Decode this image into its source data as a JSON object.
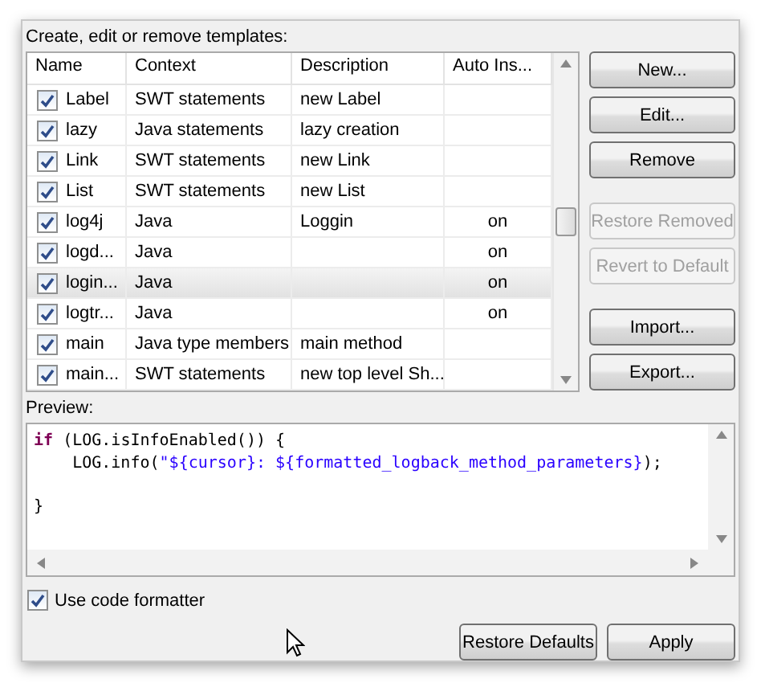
{
  "templates": {
    "label": "Create, edit or remove templates:",
    "columns": [
      "Name",
      "Context",
      "Description",
      "Auto Ins..."
    ],
    "rows": [
      {
        "checked": true,
        "selected": false,
        "name": "Label",
        "context": "SWT statements",
        "description": "new Label",
        "auto_insert": ""
      },
      {
        "checked": true,
        "selected": false,
        "name": "lazy",
        "context": "Java statements",
        "description": "lazy creation",
        "auto_insert": ""
      },
      {
        "checked": true,
        "selected": false,
        "name": "Link",
        "context": "SWT statements",
        "description": "new Link",
        "auto_insert": ""
      },
      {
        "checked": true,
        "selected": false,
        "name": "List",
        "context": "SWT statements",
        "description": "new List",
        "auto_insert": ""
      },
      {
        "checked": true,
        "selected": false,
        "name": "log4j",
        "context": "Java",
        "description": "Loggin",
        "auto_insert": "on"
      },
      {
        "checked": true,
        "selected": false,
        "name": "logd...",
        "context": "Java",
        "description": "",
        "auto_insert": "on"
      },
      {
        "checked": true,
        "selected": true,
        "name": "login...",
        "context": "Java",
        "description": "",
        "auto_insert": "on"
      },
      {
        "checked": true,
        "selected": false,
        "name": "logtr...",
        "context": "Java",
        "description": "",
        "auto_insert": "on"
      },
      {
        "checked": true,
        "selected": false,
        "name": "main",
        "context": "Java type members",
        "description": "main method",
        "auto_insert": ""
      },
      {
        "checked": true,
        "selected": false,
        "name": "main...",
        "context": "SWT statements",
        "description": "new top level Sh...",
        "auto_insert": ""
      }
    ]
  },
  "side_button_groups": [
    [
      {
        "label": "New...",
        "disabled": false
      },
      {
        "label": "Edit...",
        "disabled": false
      },
      {
        "label": "Remove",
        "disabled": false
      }
    ],
    [
      {
        "label": "Restore Removed",
        "disabled": true
      },
      {
        "label": "Revert to Default",
        "disabled": true
      }
    ],
    [
      {
        "label": "Import...",
        "disabled": false
      },
      {
        "label": "Export...",
        "disabled": false
      }
    ]
  ],
  "preview": {
    "label": "Preview:",
    "blocks": [
      [
        [
          {
            "kind": "keyword",
            "text": "if"
          },
          {
            "kind": "plain",
            "text": " (LOG.isInfoEnabled()) {"
          }
        ],
        [
          {
            "kind": "plain",
            "text": "    LOG.info("
          },
          {
            "kind": "string",
            "text": "\"${cursor}: ${formatted_logback_method_parameters}"
          },
          {
            "kind": "plain",
            "text": ");"
          }
        ]
      ],
      [
        [
          {
            "kind": "plain",
            "text": "}"
          }
        ]
      ]
    ]
  },
  "use_code_formatter": {
    "label": "Use code formatter",
    "checked": true
  },
  "footer_buttons": [
    "Restore Defaults",
    "Apply"
  ]
}
